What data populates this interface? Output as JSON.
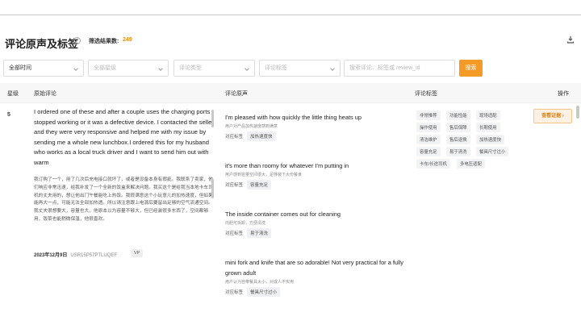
{
  "header": {
    "title": "评论原声及标签",
    "help_icon": "?",
    "count_label": "筛选结果数:",
    "count_value": "249"
  },
  "filters": {
    "time": "全部时间",
    "platform_placeholder": "全部星级",
    "review_type_placeholder": "评论类型",
    "review_tag_placeholder": "评论标签",
    "search_placeholder": "搜索评论、标签或 review_id",
    "search_button": "搜索"
  },
  "table": {
    "columns": {
      "star": "星级",
      "original": "原始评论",
      "voice": "评论原声",
      "tags": "评论标签",
      "action": "操作"
    },
    "row": {
      "star": "5",
      "original_en": "I ordered one of these and after a couple uses the charging ports stopped working or it was a defective device. I contacted the seller and they were very responsive and helped me with my issue by sending me a whole new lunchbox.I ordered this for my husband who works as a local truck driver and I want to send him out with warm",
      "original_zh": "我订购了一个，用了几次后充电接口就坏了，或者是设备本身有瑕疵。我联系了卖家，他们响应非常迅速，给我补发了一个全新的饭盒来解决问题。我买这个是给我当本地卡车司机的丈夫用的，想让他出门午餐能吃上热饭。我很满意这个小玩意儿的加热速度，但如果能再大一点，可能无法全部加热透。所以请注意跟上电源后要留出足够的空气流通空间。我丈夫很想要大，容量也大，他原本以为容量不够大，但已经装很多东西了，空间都够用，饭菜也能稍微保温，他很喜欢。",
      "date": "2023年12月9日",
      "review_id": "USR15P57PTLUQEF",
      "badge": "VP",
      "voices": [
        {
          "en": "I'm pleased with how quickly the little thing heats up",
          "zh": "用户对产品加热速度感到满意",
          "tag_label": "对应标签",
          "tag": "加热速度快"
        },
        {
          "en": "it's more than roomy for whatever I'm putting in",
          "zh": "用户感到容量空间很大，足够装下大份餐食",
          "tag_label": "对应标签",
          "tag": "容量充足"
        },
        {
          "en": "The inside container comes out for cleaning",
          "zh": "内胆可拆卸，方便清洗",
          "tag_label": "对应标签",
          "tag": "易于清洗"
        },
        {
          "en": "mini fork and knife that are so adorable! Not very practical for a fully grown adult",
          "zh": "用户认为自带餐具太小，对成人不实用",
          "tag_label": "对应标签",
          "tag": "餐具尺寸过小"
        }
      ],
      "labels": [
        "非常推荐",
        "功能性能",
        "现场适配",
        "操作使用",
        "售后保障",
        "长期使用",
        "清洁维护",
        "售后退换",
        "加热速度快",
        "容量充足",
        "易于清洗",
        "餐具尺寸过小",
        "卡车/长途司机",
        "多电压适配"
      ],
      "action": "查看证据 ›"
    }
  }
}
